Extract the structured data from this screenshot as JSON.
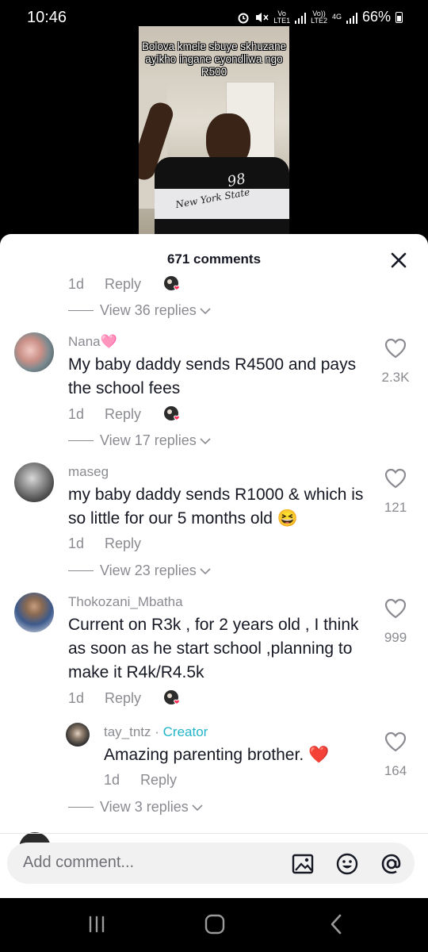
{
  "status": {
    "time": "10:46",
    "network1_top": "Vo",
    "network1_bottom": "LTE1",
    "network2_top": "Vo))",
    "network2_bottom": "LTE2",
    "gen": "4G",
    "battery": "66%"
  },
  "video": {
    "caption": "Bolova kmele sbuye skhuzane ayikho ingane eyondliwa ngo R500",
    "shirt_number": "98",
    "shirt_text": "New York State"
  },
  "sheet": {
    "title": "671 comments"
  },
  "top_meta": {
    "time": "1d",
    "reply": "Reply",
    "view_replies": "View 36 replies"
  },
  "comments": [
    {
      "username": "Nana🩷",
      "text": "My baby daddy sends R4500 and pays the school fees",
      "time": "1d",
      "reply": "Reply",
      "likes": "2.3K",
      "view_replies": "View 17 replies"
    },
    {
      "username": "maseg",
      "text": "my baby daddy sends R1000 & which is so little for our 5 months old 😆",
      "time": "1d",
      "reply": "Reply",
      "likes": "121",
      "view_replies": "View 23 replies"
    },
    {
      "username": "Thokozani_Mbatha",
      "text": "Current on R3k , for 2 years old , I think as soon as he start school ,planning to make it R4k/R4.5k",
      "time": "1d",
      "reply": "Reply",
      "likes": "999"
    }
  ],
  "reply": {
    "username": "tay_tntz",
    "separator": " · ",
    "creator_label": "Creator",
    "text": "Amazing parenting brother. ❤️",
    "time": "1d",
    "reply": "Reply",
    "likes": "164",
    "view_replies": "View 3 replies"
  },
  "comment_bar": {
    "placeholder": "Add comment..."
  },
  "colors": {
    "accent_creator": "#20b5c7",
    "heart": "#fe2c55",
    "muted": "#8a8b91"
  },
  "icons": [
    "close-icon",
    "heart-outline-icon",
    "chevron-down-icon",
    "image-icon",
    "emoji-icon",
    "at-icon",
    "recents-icon",
    "home-icon",
    "back-icon"
  ]
}
